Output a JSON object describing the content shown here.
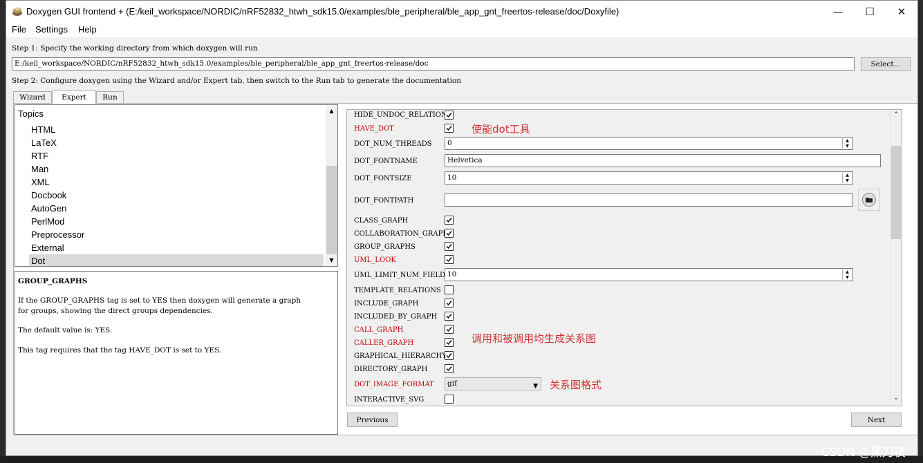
{
  "window": {
    "title": "Doxygen GUI frontend + (E:/keil_workspace/NORDIC/nRF52832_htwh_sdk15.0/examples/ble_peripheral/ble_app_gnt_freertos-release/doc/Doxyfile)",
    "controls": {
      "minimize": "—",
      "maximize": "☐",
      "close": "✕"
    }
  },
  "menu": [
    "File",
    "Settings",
    "Help"
  ],
  "step1": {
    "label": "Step 1: Specify the working directory from which doxygen will run",
    "path": "E:/keil_workspace/NORDIC/nRF52832_htwh_sdk15.0/examples/ble_peripheral/ble_app_gnt_freertos-release/doc",
    "select_button": "Select..."
  },
  "step2": {
    "label": "Step 2: Configure doxygen using the Wizard and/or Expert tab, then switch to the Run tab to generate the documentation"
  },
  "tabs": [
    "Wizard",
    "Expert",
    "Run"
  ],
  "active_tab": "Expert",
  "topics": {
    "header": "Topics",
    "items": [
      "HTML",
      "LaTeX",
      "RTF",
      "Man",
      "XML",
      "Docbook",
      "AutoGen",
      "PerlMod",
      "Preprocessor",
      "External",
      "Dot"
    ],
    "selected": "Dot"
  },
  "description": {
    "title": "GROUP_GRAPHS",
    "line1": "If the GROUP_GRAPHS tag is set to YES then doxygen will generate a graph",
    "line2": "for groups, showing the direct groups dependencies.",
    "line3": "The default value is: YES.",
    "line4": "This tag requires that the tag HAVE_DOT is set to YES."
  },
  "settings": {
    "hide_undoc_relations": {
      "label": "HIDE_UNDOC_RELATIONS",
      "checked": true
    },
    "have_dot": {
      "label": "HAVE_DOT",
      "checked": true,
      "changed": true
    },
    "dot_num_threads": {
      "label": "DOT_NUM_THREADS",
      "value": "0"
    },
    "dot_fontname": {
      "label": "DOT_FONTNAME",
      "value": "Helvetica"
    },
    "dot_fontsize": {
      "label": "DOT_FONTSIZE",
      "value": "10"
    },
    "dot_fontpath": {
      "label": "DOT_FONTPATH",
      "value": ""
    },
    "class_graph": {
      "label": "CLASS_GRAPH",
      "checked": true
    },
    "collaboration_graph": {
      "label": "COLLABORATION_GRAPH",
      "checked": true
    },
    "group_graphs": {
      "label": "GROUP_GRAPHS",
      "checked": true
    },
    "uml_look": {
      "label": "UML_LOOK",
      "checked": true,
      "changed": true
    },
    "uml_limit_num_fields": {
      "label": "UML_LIMIT_NUM_FIELDS",
      "value": "10"
    },
    "template_relations": {
      "label": "TEMPLATE_RELATIONS",
      "checked": false
    },
    "include_graph": {
      "label": "INCLUDE_GRAPH",
      "checked": true
    },
    "included_by_graph": {
      "label": "INCLUDED_BY_GRAPH",
      "checked": true
    },
    "call_graph": {
      "label": "CALL_GRAPH",
      "checked": true,
      "changed": true
    },
    "caller_graph": {
      "label": "CALLER_GRAPH",
      "checked": true,
      "changed": true
    },
    "graphical_hierarchy": {
      "label": "GRAPHICAL_HIERARCHY",
      "checked": true
    },
    "directory_graph": {
      "label": "DIRECTORY_GRAPH",
      "checked": true
    },
    "dot_image_format": {
      "label": "DOT_IMAGE_FORMAT",
      "value": "gif",
      "changed": true
    },
    "interactive_svg": {
      "label": "INTERACTIVE_SVG",
      "checked": false
    }
  },
  "annotations": {
    "have_dot": "使能dot工具",
    "call_graphs": "调用和被调用均生成关系图",
    "image_format": "关系图格式"
  },
  "nav": {
    "previous": "Previous",
    "next": "Next"
  },
  "watermark": "CSDN @黑刀夜",
  "colors": {
    "changed_label": "#c00000",
    "annotation": "#d03030",
    "selected_topic": "#d9d9d9"
  }
}
